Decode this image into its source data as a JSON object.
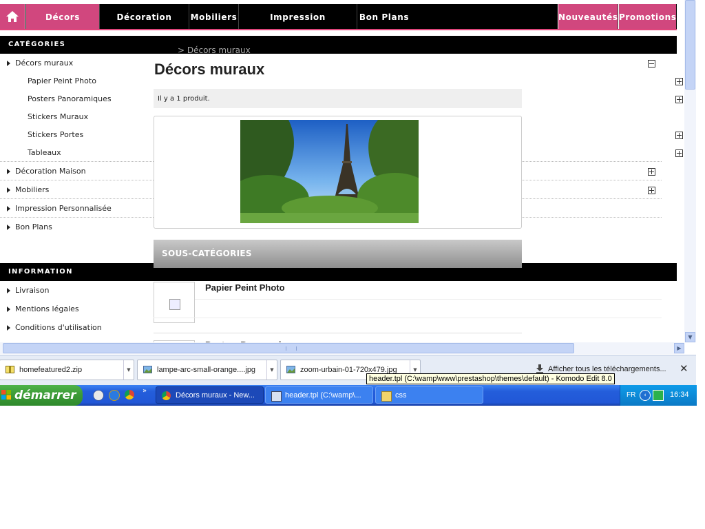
{
  "topnav": {
    "items": [
      "Décors muraux",
      "Décoration Maison",
      "Mobiliers",
      "Impression Personnalisée",
      "Bon Plans"
    ],
    "right_items": [
      "Nouveautés",
      "Promotions"
    ]
  },
  "sidebar": {
    "categories_title": "CATÉGORIES",
    "categories": [
      {
        "label": "Décors muraux"
      },
      {
        "label": "Décoration Maison"
      },
      {
        "label": "Mobiliers"
      },
      {
        "label": "Impression Personnalisée"
      },
      {
        "label": "Bon Plans"
      }
    ],
    "subcategories": [
      "Papier Peint Photo",
      "Posters Panoramiques",
      "Stickers Muraux",
      "Stickers Portes",
      "Tableaux"
    ],
    "information_title": "INFORMATION",
    "information": [
      "Livraison",
      "Mentions légales",
      "Conditions d'utilisation"
    ]
  },
  "main": {
    "breadcrumb": "> Décors muraux",
    "title": "Décors muraux",
    "product_count": "Il y a 1 produit.",
    "subcategories_title": "SOUS-CATÉGORIES",
    "subcategory_items": [
      "Papier Peint Photo",
      "Posters Panoramiques"
    ]
  },
  "downloads": {
    "items": [
      "homefeatured2.zip",
      "lampe-arc-small-orange....jpg",
      "zoom-urbain-01-720x479.jpg"
    ],
    "show_all": "Afficher tous les téléchargements...",
    "tooltip": "header.tpl (C:\\wamp\\www\\prestashop\\themes\\default) - Komodo Edit 8.0"
  },
  "taskbar": {
    "start_label": "démarrer",
    "tasks": [
      "Décors muraux - New...",
      "header.tpl (C:\\wamp\\...",
      "css"
    ],
    "lang": "FR",
    "clock": "16:34"
  },
  "colors": {
    "brand_pink": "#d1477e",
    "nav_black": "#000000",
    "xp_blue": "#245edb",
    "xp_green": "#3c9b37"
  }
}
